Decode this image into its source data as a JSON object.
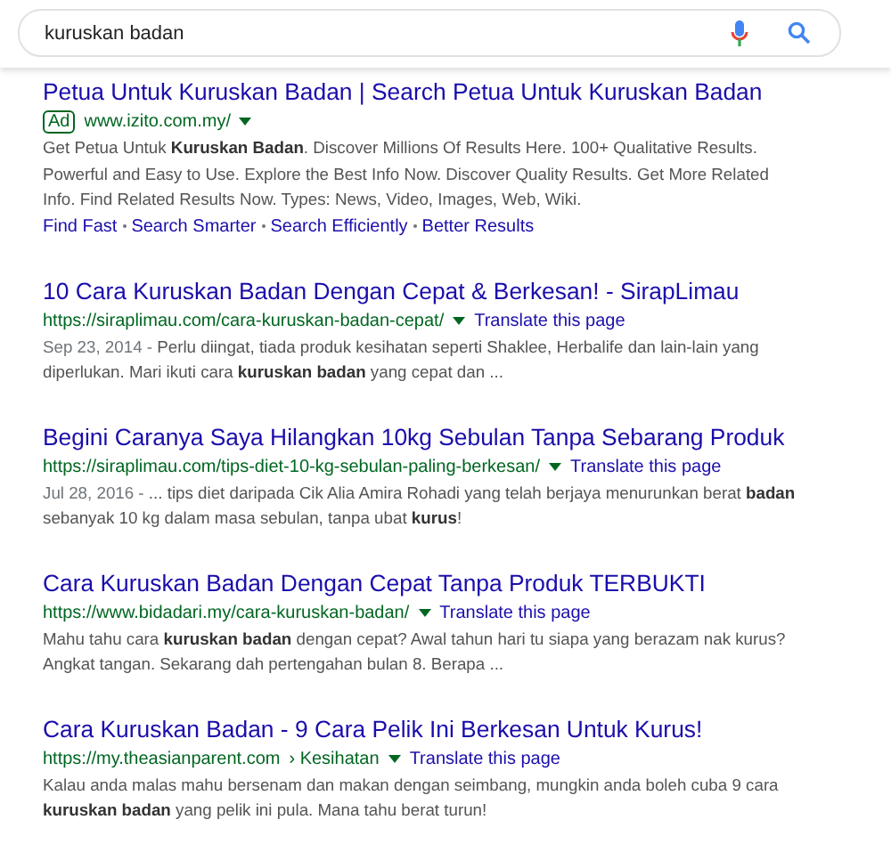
{
  "search": {
    "value": "kuruskan badan"
  },
  "ad": {
    "title": "Petua Untuk Kuruskan Badan | Search Petua Untuk Kuruskan Badan",
    "badge": "Ad",
    "url": "www.izito.com.my/",
    "snippet": "Get Petua Untuk **Kuruskan Badan**. Discover Millions Of Results Here. 100+ Qualitative Results. Powerful and Easy to Use. Explore the Best Info Now. Discover Quality Results. Get More Related Info. Find Related Results Now. Types: News, Video, Images, Web, Wiki.",
    "sitelinks": [
      "Find Fast",
      "Search Smarter",
      "Search Efficiently",
      "Better Results"
    ]
  },
  "results": [
    {
      "title": "10 Cara Kuruskan Badan Dengan Cepat & Berkesan! - SirapLimau",
      "url": "https://siraplimau.com/cara-kuruskan-badan-cepat/",
      "translate": "Translate this page",
      "date": "Sep 23, 2014 -",
      "snippet": "Perlu diingat, tiada produk kesihatan seperti Shaklee, Herbalife dan lain-lain yang diperlukan. Mari ikuti cara **kuruskan badan** yang cepat dan ..."
    },
    {
      "title": "Begini Caranya Saya Hilangkan 10kg Sebulan Tanpa Sebarang Produk",
      "url": "https://siraplimau.com/tips-diet-10-kg-sebulan-paling-berkesan/",
      "translate": "Translate this page",
      "date": "Jul 28, 2016 -",
      "snippet": "... tips diet daripada Cik Alia Amira Rohadi yang telah berjaya menurunkan berat **badan** sebanyak 10 kg dalam masa sebulan, tanpa ubat **kurus**!"
    },
    {
      "title": "Cara Kuruskan Badan Dengan Cepat Tanpa Produk TERBUKTI",
      "url": "https://www.bidadari.my/cara-kuruskan-badan/",
      "translate": "Translate this page",
      "snippet": "Mahu tahu cara **kuruskan badan** dengan cepat? Awal tahun hari tu siapa yang berazam nak kurus? Angkat tangan. Sekarang dah pertengahan bulan 8. Berapa ..."
    },
    {
      "title": "Cara Kuruskan Badan - 9 Cara Pelik Ini Berkesan Untuk Kurus!",
      "url": "https://my.theasianparent.com",
      "breadcrumb": "› Kesihatan",
      "translate": "Translate this page",
      "snippet": "Kalau anda malas mahu bersenam dan makan dengan seimbang, mungkin anda boleh cuba 9 cara **kuruskan badan** yang pelik ini pula. Mana tahu berat turun!"
    }
  ]
}
